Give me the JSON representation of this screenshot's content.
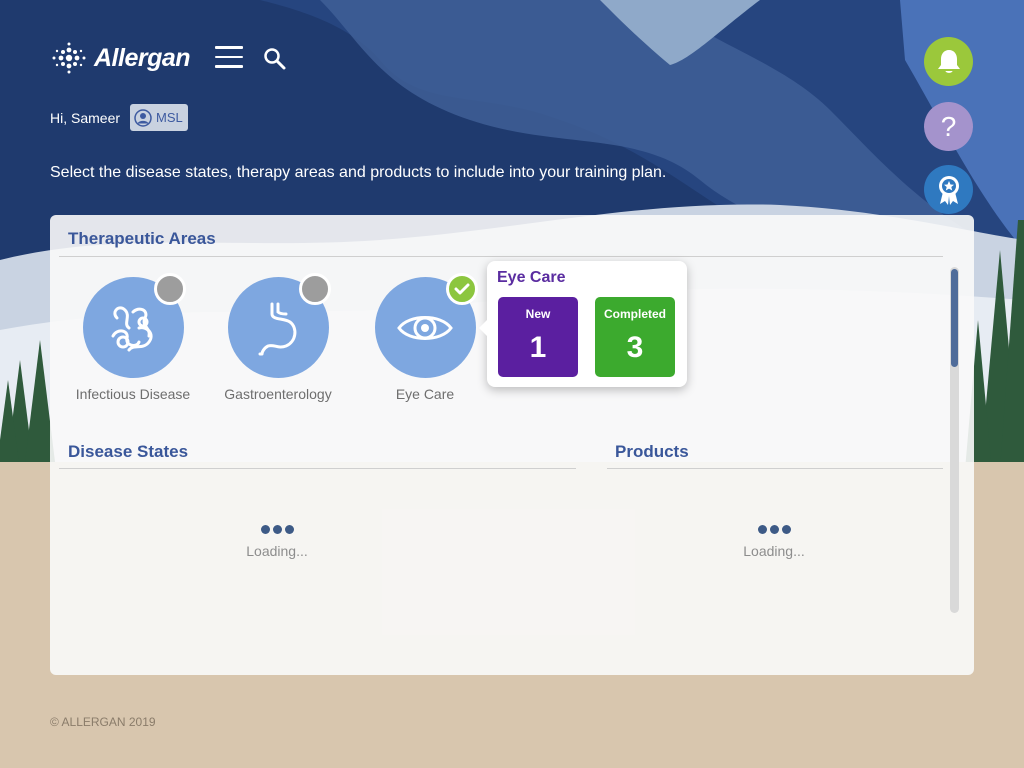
{
  "header": {
    "brand": "Allergan",
    "menu_icon": "hamburger-menu-icon",
    "search_icon": "search-icon"
  },
  "user": {
    "greeting": "Hi, Sameer",
    "role": "MSL"
  },
  "instruction": "Select the disease states, therapy areas and products to include into your training plan.",
  "actions": {
    "notifications_icon": "bell-icon",
    "help_label": "?",
    "awards_icon": "award-ribbon-icon"
  },
  "therapeutic_areas": {
    "title": "Therapeutic Areas",
    "items": [
      {
        "label": "Infectious Disease",
        "icon": "bacteria-icon",
        "selected": false
      },
      {
        "label": "Gastroenterology",
        "icon": "stomach-icon",
        "selected": false
      },
      {
        "label": "Eye Care",
        "icon": "eye-icon",
        "selected": true
      }
    ]
  },
  "popover": {
    "title": "Eye Care",
    "new_label": "New",
    "new_value": "1",
    "completed_label": "Completed",
    "completed_value": "3"
  },
  "disease_states": {
    "title": "Disease States",
    "loading_text": "Loading..."
  },
  "products": {
    "title": "Products",
    "loading_text": "Loading..."
  },
  "footer": {
    "copyright": "© ALLERGAN 2019"
  },
  "colors": {
    "sky_dark": "#1f3a6e",
    "accent_blue": "#3a579a",
    "area_circle": "#7ea7e0",
    "new_purple": "#5b1fa0",
    "completed_green": "#3caa2e",
    "bell_green": "#9bc83b",
    "help_purple": "#a493cc",
    "award_blue": "#2f79c0"
  }
}
